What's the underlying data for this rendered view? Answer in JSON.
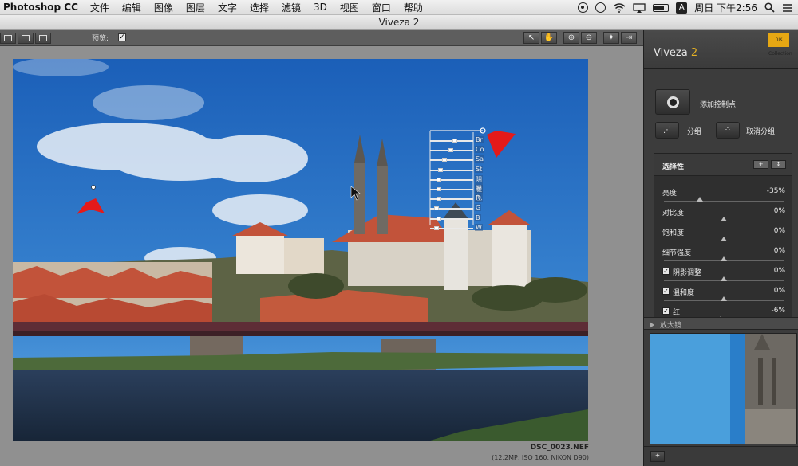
{
  "menubar": {
    "app": "Photoshop CC",
    "items": [
      "文件",
      "编辑",
      "图像",
      "图层",
      "文字",
      "选择",
      "滤镜",
      "3D",
      "视图",
      "窗口",
      "帮助"
    ],
    "clock": "周日 下午2:56",
    "input_source": "A"
  },
  "window": {
    "title": "Viveza 2"
  },
  "toolbar": {
    "preview_label": "预览:",
    "preview_checked": "✓"
  },
  "image": {
    "filename": "DSC_0023.NEF",
    "info": "(12.2MP, ISO 160, NIKON D90)"
  },
  "control_point": {
    "labels": [
      "Br",
      "Co",
      "Sa",
      "St",
      "阴影",
      "暖色",
      "R",
      "G",
      "B",
      "W"
    ],
    "slider_levels": [
      0.55,
      0.45,
      0.3,
      0.2,
      0.15,
      0.15,
      0.15,
      0.1,
      0.15,
      0.1
    ]
  },
  "panel": {
    "app_name": "Viveza",
    "version": "2",
    "logo_text": "nik Collection",
    "add_cp_label": "添加控制点",
    "group_label": "分组",
    "ungroup_label": "取消分组",
    "selectivity_title": "选择性",
    "sliders": [
      {
        "name": "亮度",
        "value": "-35%",
        "level": 0.3,
        "checkbox": false
      },
      {
        "name": "对比度",
        "value": "0%",
        "level": 0.5,
        "checkbox": false
      },
      {
        "name": "饱和度",
        "value": "0%",
        "level": 0.5,
        "checkbox": false
      },
      {
        "name": "细节强度",
        "value": "0%",
        "level": 0.5,
        "checkbox": false
      },
      {
        "name": "阴影调整",
        "value": "0%",
        "level": 0.5,
        "checkbox": true
      },
      {
        "name": "温和度",
        "value": "0%",
        "level": 0.5,
        "checkbox": true
      },
      {
        "name": "红",
        "value": "-6%",
        "level": 0.47,
        "checkbox": true
      }
    ],
    "loupe_title": "放大镜"
  },
  "colors": {
    "accent": "#e6b224",
    "sky": "#2a74c8",
    "control_point_marker": "#e41a1a"
  }
}
